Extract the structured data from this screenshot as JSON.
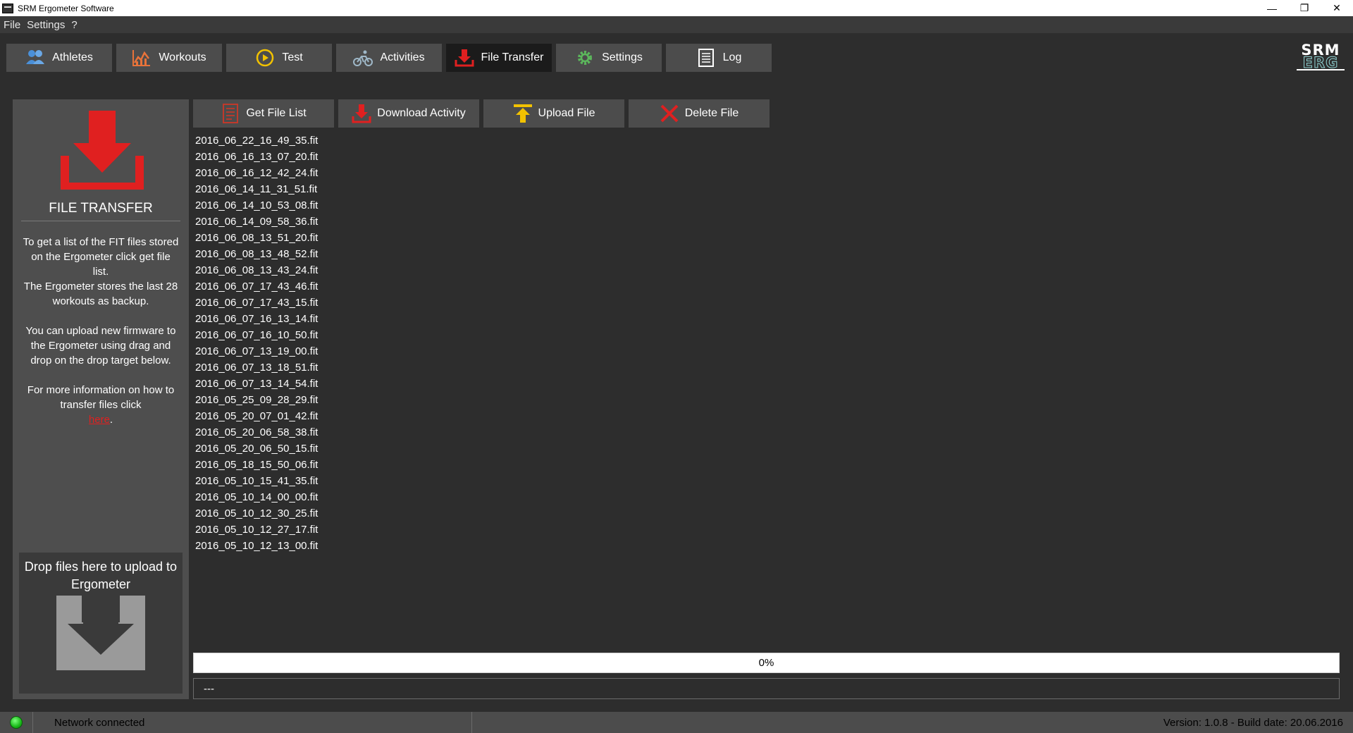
{
  "window": {
    "title": "SRM Ergometer Software",
    "controls": {
      "minimize": "—",
      "restore": "❐",
      "close": "✕"
    }
  },
  "menu": [
    "File",
    "Settings",
    "?"
  ],
  "nav": {
    "tabs": [
      {
        "label": "Athletes",
        "icon": "athletes-icon",
        "active": false
      },
      {
        "label": "Workouts",
        "icon": "workouts-chart-icon",
        "active": false
      },
      {
        "label": "Test",
        "icon": "test-play-icon",
        "active": false
      },
      {
        "label": "Activities",
        "icon": "cyclist-icon",
        "active": false
      },
      {
        "label": "File Transfer",
        "icon": "download-icon",
        "active": true
      },
      {
        "label": "Settings",
        "icon": "gear-icon",
        "active": false
      },
      {
        "label": "Log",
        "icon": "log-list-icon",
        "active": false
      }
    ]
  },
  "brand": {
    "line1": "SRM",
    "line2": "ERG"
  },
  "side": {
    "title": "FILE TRANSFER",
    "para1a": "To get a list of the FIT files stored on the Ergometer click get file list.",
    "para1b": "The Ergometer stores the last 28 workouts as backup.",
    "para2": "You can upload new firmware to the Ergometer using drag and drop on the drop target below.",
    "para3": "For more information on how to transfer files click",
    "link": "here",
    "para3_end": ".",
    "drop_label": "Drop files here to upload to Ergometer"
  },
  "toolbar": {
    "get_list": "Get File List",
    "download": "Download Activity",
    "upload": "Upload File",
    "delete": "Delete File"
  },
  "files": [
    "2016_06_22_16_49_35.fit",
    "2016_06_16_13_07_20.fit",
    "2016_06_16_12_42_24.fit",
    "2016_06_14_11_31_51.fit",
    "2016_06_14_10_53_08.fit",
    "2016_06_14_09_58_36.fit",
    "2016_06_08_13_51_20.fit",
    "2016_06_08_13_48_52.fit",
    "2016_06_08_13_43_24.fit",
    "2016_06_07_17_43_46.fit",
    "2016_06_07_17_43_15.fit",
    "2016_06_07_16_13_14.fit",
    "2016_06_07_16_10_50.fit",
    "2016_06_07_13_19_00.fit",
    "2016_06_07_13_18_51.fit",
    "2016_06_07_13_14_54.fit",
    "2016_05_25_09_28_29.fit",
    "2016_05_20_07_01_42.fit",
    "2016_05_20_06_58_38.fit",
    "2016_05_20_06_50_15.fit",
    "2016_05_18_15_50_06.fit",
    "2016_05_10_15_41_35.fit",
    "2016_05_10_14_00_00.fit",
    "2016_05_10_12_30_25.fit",
    "2016_05_10_12_27_17.fit",
    "2016_05_10_12_13_00.fit"
  ],
  "progress": {
    "value": 0,
    "label": "0%"
  },
  "status_field": "---",
  "statusbar": {
    "network": "Network connected",
    "version": "Version: 1.0.8 - Build date: 20.06.2016"
  },
  "colors": {
    "accent_red": "#e02020",
    "upload_yellow": "#f2c200",
    "gear_green": "#5cb85c",
    "athletes_blue": "#4a90d9",
    "led_green": "#18b818"
  }
}
